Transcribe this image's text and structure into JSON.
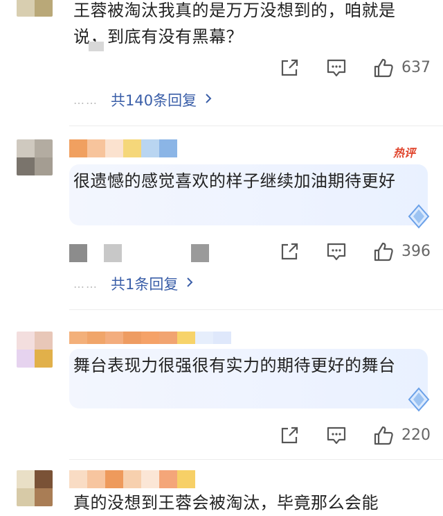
{
  "comments": [
    {
      "text": "王蓉被淘汰我真的是万万没想到的，咱就是说，到底有没有黑幕？",
      "likes": "637",
      "replies": "共140条回复",
      "hot": false
    },
    {
      "text": "很遗憾的感觉喜欢的样子继续加油期待更好",
      "likes": "396",
      "replies": "共1条回复",
      "hot": true,
      "badge": "热评"
    },
    {
      "text": "舞台表现力很强很有实力的期待更好的舞台",
      "likes": "220",
      "hot": false
    },
    {
      "text": "真的没想到王蓉会被淘汰，毕竟那么会能"
    }
  ],
  "icons": {
    "share": "share-icon",
    "comment": "comment-icon",
    "like": "thumbs-up-icon",
    "reply_more": "chevron-right-icon",
    "reply_dots": "……"
  },
  "colors": {
    "link": "#3a5ea8",
    "hot_badge": "#e0442c",
    "bubble": "#eef3ff"
  }
}
